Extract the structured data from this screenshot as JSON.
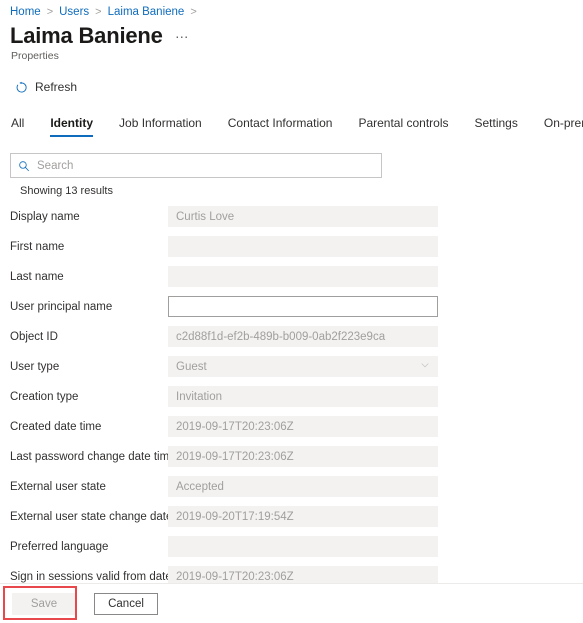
{
  "breadcrumb": {
    "items": [
      "Home",
      "Users",
      "Laima Baniene"
    ],
    "separator": ">"
  },
  "header": {
    "title": "Laima Baniene",
    "subtitle": "Properties",
    "overflow_label": "…"
  },
  "command_bar": {
    "refresh_label": "Refresh",
    "refresh_icon": "refresh-icon"
  },
  "tabs": [
    {
      "label": "All",
      "active": false
    },
    {
      "label": "Identity",
      "active": true
    },
    {
      "label": "Job Information",
      "active": false
    },
    {
      "label": "Contact Information",
      "active": false
    },
    {
      "label": "Parental controls",
      "active": false
    },
    {
      "label": "Settings",
      "active": false
    },
    {
      "label": "On-premises",
      "active": false
    }
  ],
  "search": {
    "placeholder": "Search",
    "value": "",
    "icon": "search-icon"
  },
  "results": {
    "text": "Showing 13 results"
  },
  "fields": [
    {
      "label": "Display name",
      "value": "Curtis Love",
      "type": "readonly"
    },
    {
      "label": "First name",
      "value": "",
      "type": "readonly"
    },
    {
      "label": "Last name",
      "value": "",
      "type": "readonly"
    },
    {
      "label": "User principal name",
      "value": "",
      "type": "editable"
    },
    {
      "label": "Object ID",
      "value": "c2d88f1d-ef2b-489b-b009-0ab2f223e9ca",
      "type": "readonly"
    },
    {
      "label": "User type",
      "value": "Guest",
      "type": "dropdown"
    },
    {
      "label": "Creation type",
      "value": "Invitation",
      "type": "readonly"
    },
    {
      "label": "Created date time",
      "value": "2019-09-17T20:23:06Z",
      "type": "readonly"
    },
    {
      "label": "Last password change date time",
      "value": "2019-09-17T20:23:06Z",
      "type": "readonly"
    },
    {
      "label": "External user state",
      "value": "Accepted",
      "type": "readonly"
    },
    {
      "label": "External user state change date time",
      "value": "2019-09-20T17:19:54Z",
      "type": "readonly"
    },
    {
      "label": "Preferred language",
      "value": "",
      "type": "readonly"
    },
    {
      "label": "Sign in sessions valid from date time",
      "value": "2019-09-17T20:23:06Z",
      "type": "readonly"
    }
  ],
  "footer": {
    "save_label": "Save",
    "cancel_label": "Cancel"
  },
  "colors": {
    "accent": "#0f6cbd",
    "link": "#0f6cbd",
    "annotation": "#e8484b",
    "field_bg": "#f3f2f1",
    "text": "#323130",
    "muted": "#a19f9d"
  }
}
